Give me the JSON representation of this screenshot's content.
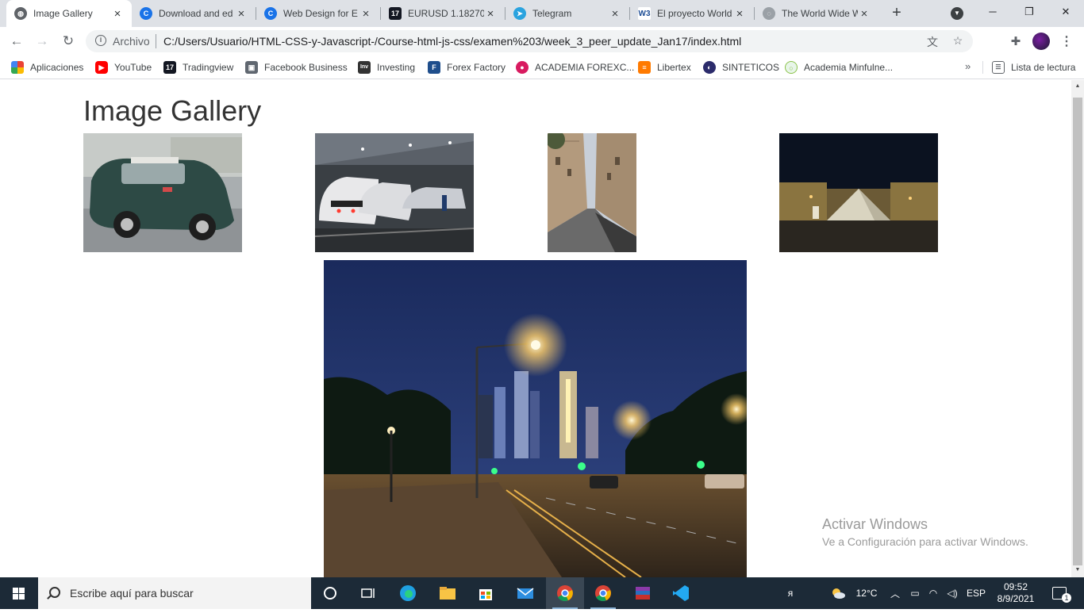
{
  "tabs": [
    {
      "title": "Image Gallery",
      "active": true,
      "icon": "globe-icon"
    },
    {
      "title": "Download and ed",
      "active": false,
      "icon": "c-logo-icon"
    },
    {
      "title": "Web Design for E",
      "active": false,
      "icon": "c-logo-icon"
    },
    {
      "title": "EURUSD 1.18270",
      "active": false,
      "icon": "tradingview-icon"
    },
    {
      "title": "Telegram",
      "active": false,
      "icon": "telegram-icon"
    },
    {
      "title": "El proyecto World",
      "active": false,
      "icon": "w3-icon"
    },
    {
      "title": "The World Wide W",
      "active": false,
      "icon": "www-icon"
    }
  ],
  "address": {
    "scheme_label": "Archivo",
    "url": "C:/Users/Usuario/HTML-CSS-y-Javascript-/Course-html-js-css/examen%203/week_3_peer_update_Jan17/index.html"
  },
  "bookmarks": [
    {
      "label": "Aplicaciones",
      "icon": "apps-grid-icon",
      "color": "#ea4335"
    },
    {
      "label": "YouTube",
      "icon": "youtube-icon",
      "color": "#ff0000"
    },
    {
      "label": "Tradingview",
      "icon": "tradingview-icon",
      "color": "#131722"
    },
    {
      "label": "Facebook Business",
      "icon": "briefcase-icon",
      "color": "#606770"
    },
    {
      "label": "Investing",
      "icon": "investing-icon",
      "color": "#333333"
    },
    {
      "label": "Forex Factory",
      "icon": "forex-factory-icon",
      "color": "#1f4e8c"
    },
    {
      "label": "ACADEMIA FOREXC...",
      "icon": "academia-icon",
      "color": "#d81b60"
    },
    {
      "label": "Libertex",
      "icon": "libertex-icon",
      "color": "#ff7a00"
    },
    {
      "label": "SINTETICOS",
      "icon": "sinteticos-icon",
      "color": "#2b2b6b"
    },
    {
      "label": "Academia Minfulne...",
      "icon": "mindfulness-icon",
      "color": "#8bc34a"
    }
  ],
  "bookmarks_more": "»",
  "reading_list": "Lista de lectura",
  "page": {
    "title": "Image Gallery",
    "images": [
      {
        "name": "car-photo",
        "alt": "Green mini car parked on street"
      },
      {
        "name": "train-photo",
        "alt": "High-speed trains in station"
      },
      {
        "name": "street-photo",
        "alt": "Narrow Paris street"
      },
      {
        "name": "louvre-photo",
        "alt": "Louvre pyramid at night"
      },
      {
        "name": "city-night-photo",
        "alt": "City skyline at night"
      }
    ]
  },
  "watermark": {
    "title": "Activar Windows",
    "subtitle": "Ve a Configuración para activar Windows."
  },
  "taskbar": {
    "search_placeholder": "Escribe aquí para buscar",
    "temperature": "12°C",
    "language": "ESP",
    "time": "09:52",
    "date": "8/9/2021",
    "notifications": "1"
  },
  "colors": {
    "tabstrip": "#dee1e6",
    "taskbar": "#1c2a37",
    "accent": "#1a73e8"
  }
}
